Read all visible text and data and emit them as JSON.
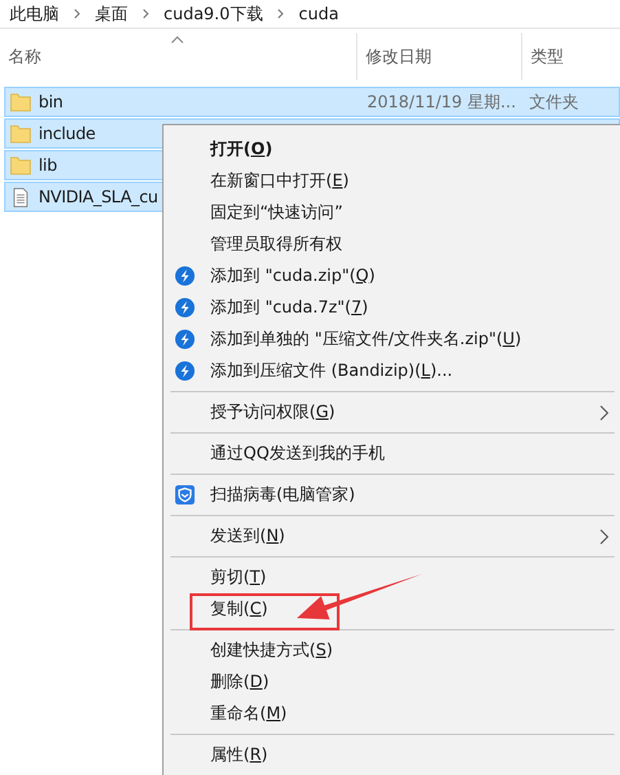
{
  "breadcrumb": [
    "此电脑",
    "桌面",
    "cuda9.0下载",
    "cuda"
  ],
  "columns": [
    {
      "label": "名称",
      "sorted": true
    },
    {
      "label": "修改日期",
      "sorted": false
    },
    {
      "label": "类型",
      "sorted": false
    }
  ],
  "files": [
    {
      "name": "bin",
      "kind": "folder",
      "date": "2018/11/19 星期...",
      "type": "文件夹",
      "selected": true
    },
    {
      "name": "include",
      "kind": "folder",
      "selected": true
    },
    {
      "name": "lib",
      "kind": "folder",
      "selected": true
    },
    {
      "name": "NVIDIA_SLA_cu",
      "kind": "file",
      "selected": true
    }
  ],
  "context_menu": [
    {
      "kind": "item",
      "label": "打开(",
      "key": "O",
      "after": ")",
      "default": true
    },
    {
      "kind": "item",
      "label": "在新窗口中打开(",
      "key": "E",
      "after": ")"
    },
    {
      "kind": "item",
      "label": "固定到“快速访问”"
    },
    {
      "kind": "item",
      "label": "管理员取得所有权"
    },
    {
      "kind": "archive",
      "label": "添加到 \"cuda.zip\"(",
      "key": "Q",
      "after": ")"
    },
    {
      "kind": "archive",
      "label": "添加到 \"cuda.7z\"(",
      "key": "7",
      "after": ")"
    },
    {
      "kind": "archive",
      "label": "添加到单独的 \"压缩文件/文件夹名.zip\"(",
      "key": "U",
      "after": ")"
    },
    {
      "kind": "archive",
      "label": "添加到压缩文件 (Bandizip)(",
      "key": "L",
      "after": ")..."
    },
    {
      "kind": "separator"
    },
    {
      "kind": "item",
      "label": "授予访问权限(",
      "key": "G",
      "after": ")",
      "submenu": true
    },
    {
      "kind": "separator"
    },
    {
      "kind": "item",
      "label": "通过QQ发送到我的手机"
    },
    {
      "kind": "separator"
    },
    {
      "kind": "scan",
      "label": "扫描病毒(电脑管家)"
    },
    {
      "kind": "separator"
    },
    {
      "kind": "item",
      "label": "发送到(",
      "key": "N",
      "after": ")",
      "submenu": true
    },
    {
      "kind": "separator"
    },
    {
      "kind": "item",
      "label": "剪切(",
      "key": "T",
      "after": ")"
    },
    {
      "kind": "item",
      "label": "复制(",
      "key": "C",
      "after": ")",
      "annotated": true
    },
    {
      "kind": "separator"
    },
    {
      "kind": "item",
      "label": "创建快捷方式(",
      "key": "S",
      "after": ")"
    },
    {
      "kind": "item",
      "label": "删除(",
      "key": "D",
      "after": ")"
    },
    {
      "kind": "item",
      "label": "重命名(",
      "key": "M",
      "after": ")"
    },
    {
      "kind": "separator"
    },
    {
      "kind": "item",
      "label": "属性(",
      "key": "R",
      "after": ")"
    }
  ]
}
